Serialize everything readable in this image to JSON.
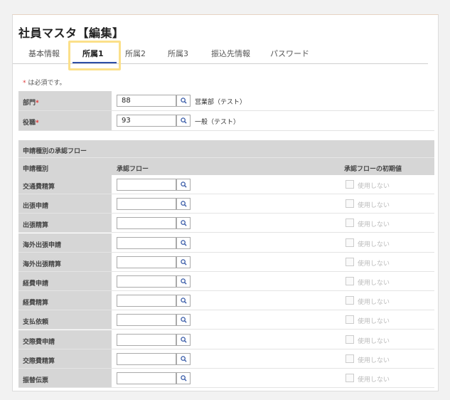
{
  "page_title": "社員マスタ【編集】",
  "tabs": [
    {
      "label": "基本情報"
    },
    {
      "label": "所属1"
    },
    {
      "label": "所属2"
    },
    {
      "label": "所属3"
    },
    {
      "label": "振込先情報"
    },
    {
      "label": "パスワード"
    }
  ],
  "required_note": {
    "mark": "*",
    "text": " は必須です。"
  },
  "fields": [
    {
      "label": "部門",
      "required_mark": "*",
      "value": "88",
      "name": "営業部（テスト）"
    },
    {
      "label": "役職",
      "required_mark": "*",
      "value": "93",
      "name": "一般（テスト）"
    }
  ],
  "flow_section": {
    "title": "申請種別の承認フロー",
    "headers": {
      "type": "申請種別",
      "flow": "承認フロー",
      "default": "承認フローの初期値"
    },
    "checkbox_label": "使用しない",
    "rows": [
      {
        "label": "交通費精算"
      },
      {
        "label": "出張申請"
      },
      {
        "label": "出張精算"
      },
      {
        "label": "海外出張申請"
      },
      {
        "label": "海外出張精算"
      },
      {
        "label": "経費申請"
      },
      {
        "label": "経費精算"
      },
      {
        "label": "支払依頼"
      },
      {
        "label": "交際費申請"
      },
      {
        "label": "交際費精算"
      },
      {
        "label": "振替伝票"
      }
    ]
  },
  "colors": {
    "accent": "#2e4fa5",
    "highlight": "#fbe08a",
    "required": "#e03a3a",
    "label_bg": "#d6d6d6"
  }
}
